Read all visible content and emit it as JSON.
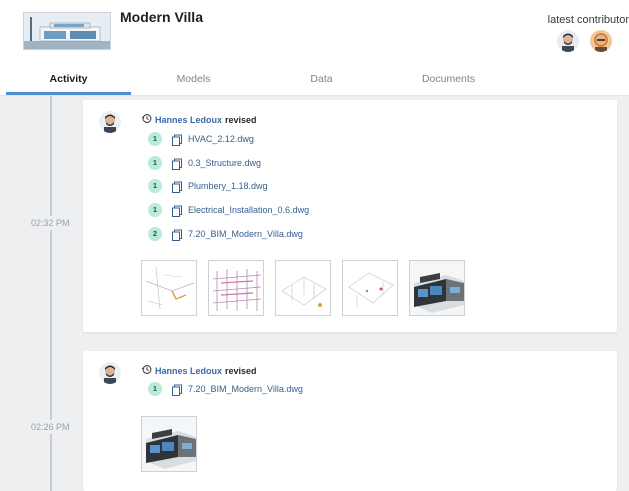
{
  "project": {
    "title": "Modern Villa",
    "contributors_label": "latest contributor"
  },
  "tabs": [
    {
      "label": "Activity",
      "active": true
    },
    {
      "label": "Models",
      "active": false
    },
    {
      "label": "Data",
      "active": false
    },
    {
      "label": "Documents",
      "active": false
    }
  ],
  "activities": [
    {
      "time": "02:32 PM",
      "user": "Hannes Ledoux",
      "action": "revised",
      "files": [
        {
          "version": "1",
          "name": "HVAC_2.12.dwg"
        },
        {
          "version": "1",
          "name": "0.3_Structure.dwg"
        },
        {
          "version": "1",
          "name": "Plumbery_1.18.dwg"
        },
        {
          "version": "1",
          "name": "Electrical_Installation_0.6.dwg"
        },
        {
          "version": "2",
          "name": "7.20_BIM_Modern_Villa.dwg"
        }
      ],
      "previews": [
        "hvac-drawing-preview",
        "structure-drawing-preview",
        "plumbing-drawing-preview",
        "electrical-drawing-preview",
        "villa-render-preview"
      ]
    },
    {
      "time": "02:26 PM",
      "user": "Hannes Ledoux",
      "action": "revised",
      "files": [
        {
          "version": "1",
          "name": "7.20_BIM_Modern_Villa.dwg"
        }
      ],
      "previews": [
        "villa-render-preview"
      ]
    }
  ],
  "colors": {
    "accent": "#4a8fd6",
    "badge": "#b9ecd7",
    "link": "#3b6aa8",
    "background": "#eeeff1"
  }
}
